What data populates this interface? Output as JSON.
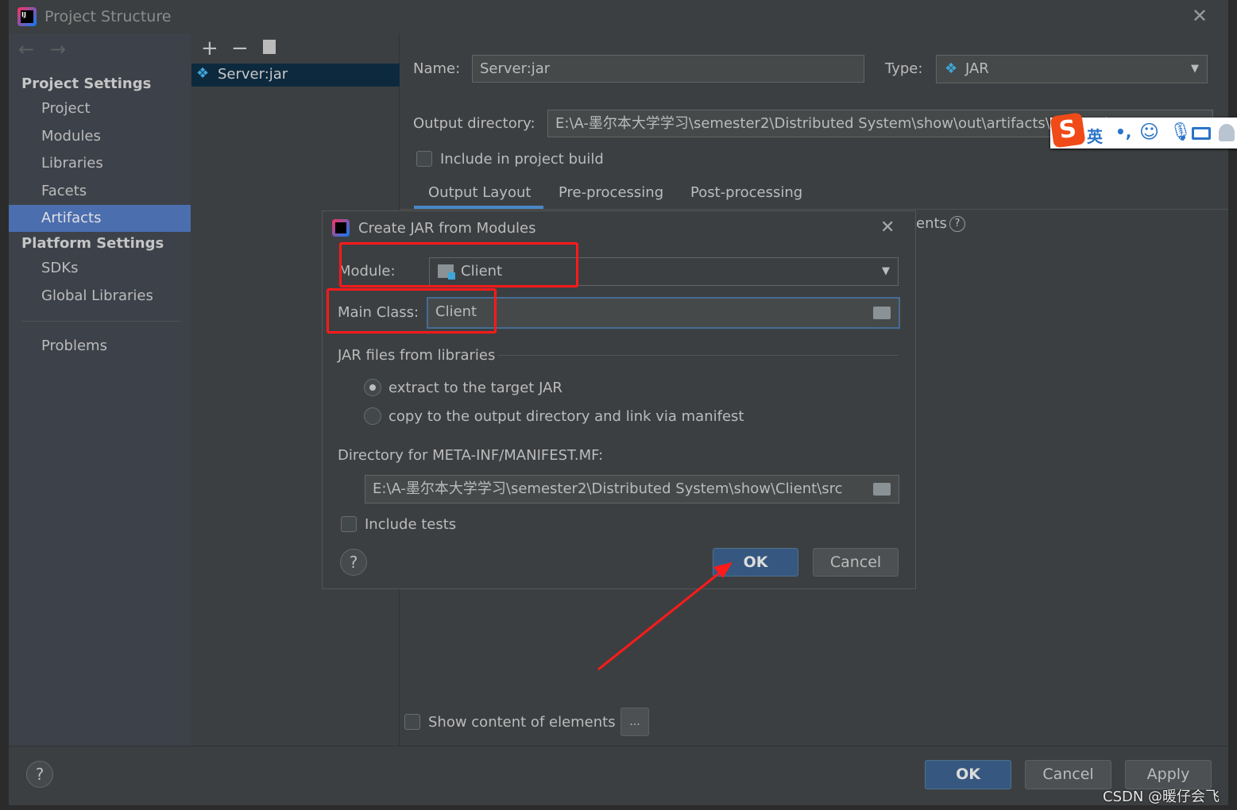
{
  "window": {
    "title": "Project Structure"
  },
  "sidebar": {
    "section1": "Project Settings",
    "items1": [
      "Project",
      "Modules",
      "Libraries",
      "Facets",
      "Artifacts"
    ],
    "selected": "Artifacts",
    "section2": "Platform Settings",
    "items2": [
      "SDKs",
      "Global Libraries"
    ],
    "problems": "Problems"
  },
  "list": {
    "items": [
      "Server:jar"
    ]
  },
  "artifact": {
    "name_label": "Name:",
    "name_value": "Server:jar",
    "type_label": "Type:",
    "type_value": "JAR",
    "output_label": "Output directory:",
    "output_value": "E:\\A-墨尔本大学学习\\semester2\\Distributed System\\show\\out\\artifacts\\Server_jar",
    "include_build": "Include in project build",
    "tabs": [
      "Output Layout",
      "Pre-processing",
      "Post-processing"
    ],
    "elements_partial": "ents",
    "show_content": "Show content of elements",
    "more_btn": "..."
  },
  "ime": {
    "lang": "英",
    "punct": "•,"
  },
  "dialog": {
    "title": "Create JAR from Modules",
    "module_label": "Module:",
    "module_value": "Client",
    "main_class_label": "Main Class:",
    "main_class_value": "Client",
    "libs_label": "JAR files from libraries",
    "radio1": "extract to the target JAR",
    "radio2": "copy to the output directory and link via manifest",
    "radio_selected": 1,
    "manifest_label": "Directory for META-INF/MANIFEST.MF:",
    "manifest_value": "E:\\A-墨尔本大学学习\\semester2\\Distributed System\\show\\Client\\src",
    "include_tests": "Include tests",
    "ok": "OK",
    "cancel": "Cancel",
    "help": "?"
  },
  "footer": {
    "ok": "OK",
    "cancel": "Cancel",
    "apply": "Apply",
    "help": "?"
  },
  "watermark": "CSDN @暖仔会飞",
  "colors": {
    "accent": "#4b6eaf",
    "annotation": "#ff1a1a",
    "default_button": "#365880"
  }
}
